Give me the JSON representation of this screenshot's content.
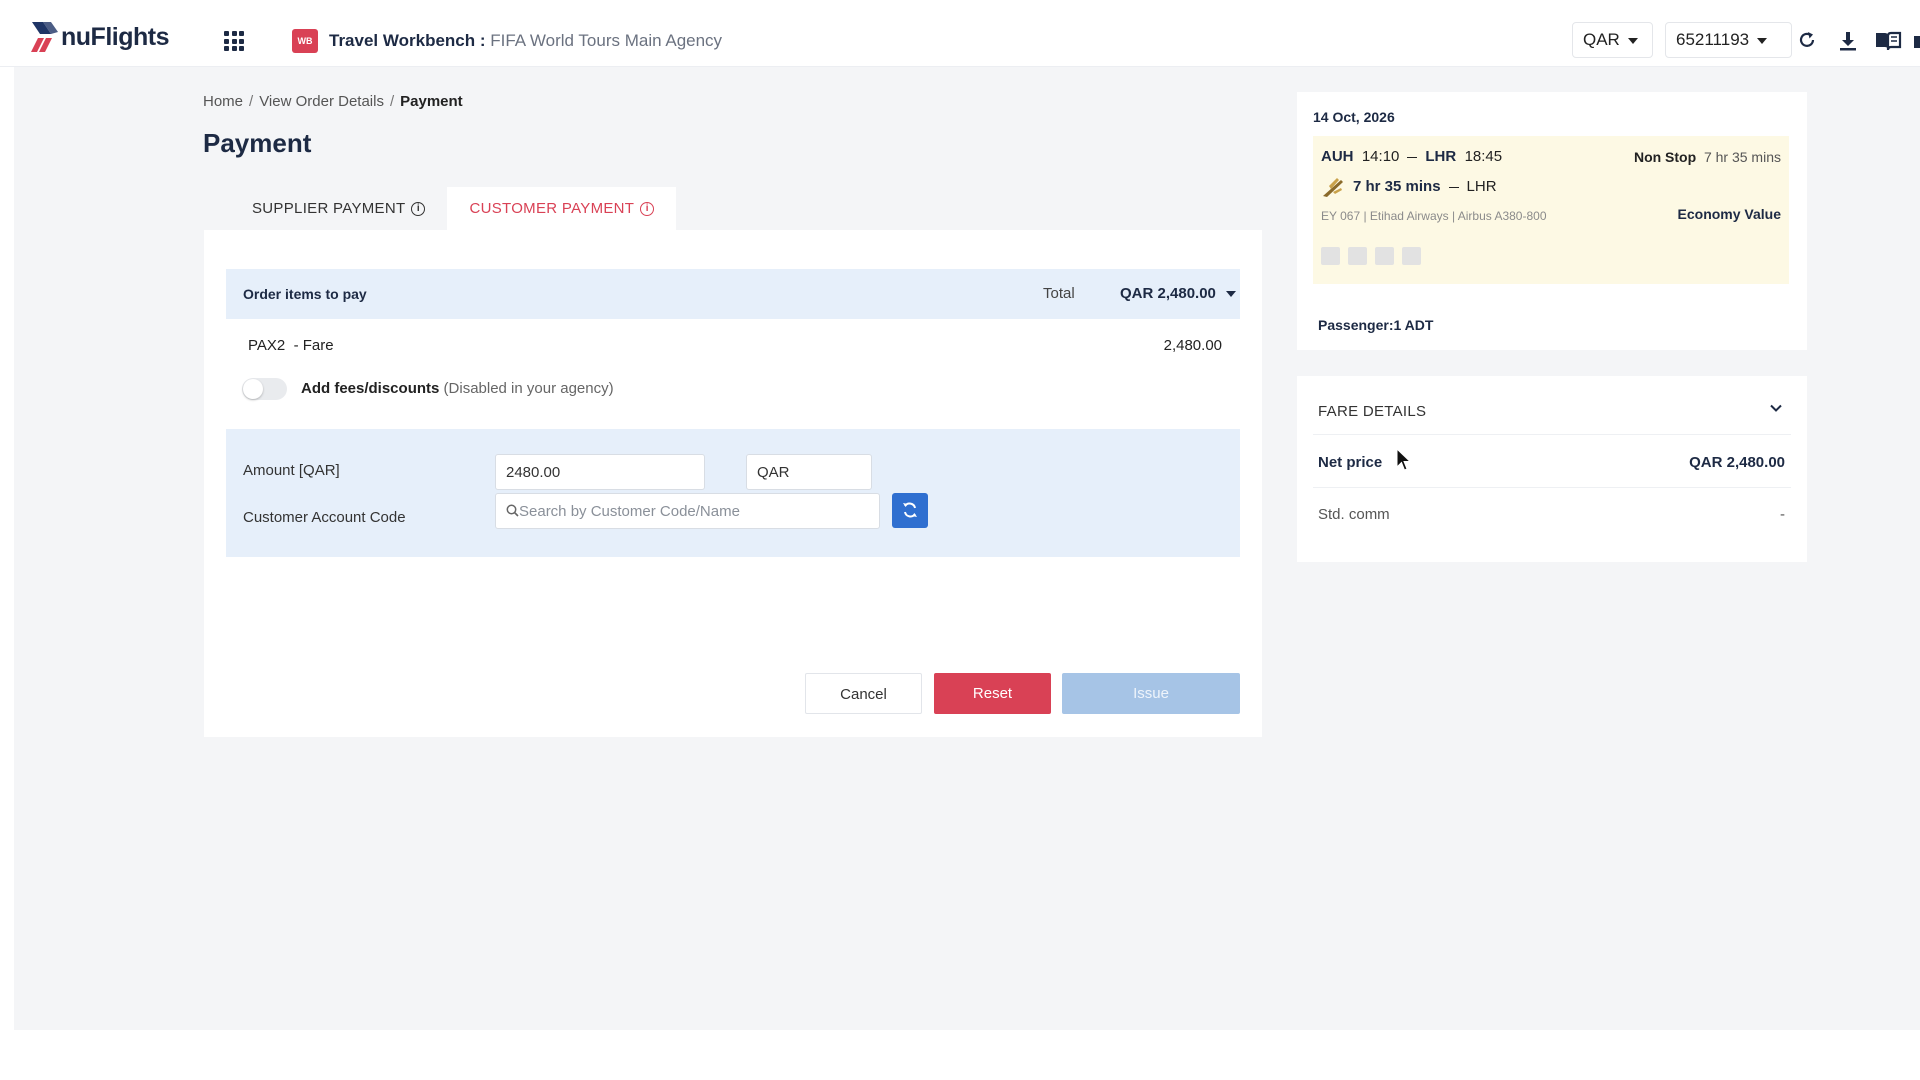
{
  "header": {
    "logo_text": "nuFlights",
    "workbench_icon": "WB",
    "workbench_title": "Travel Workbench :",
    "agency": "FIFA World Tours Main Agency",
    "currency": "QAR",
    "account": "65211193",
    "icons": [
      "apps-grid-icon",
      "refresh-icon",
      "download-icon",
      "book-icon"
    ]
  },
  "breadcrumb": {
    "home": "Home",
    "sep": "/",
    "order": "View Order Details",
    "current": "Payment"
  },
  "page_title": "Payment",
  "tabs": [
    {
      "label": "SUPPLIER PAYMENT",
      "active": false
    },
    {
      "label": "CUSTOMER PAYMENT",
      "active": true
    }
  ],
  "order": {
    "heading": "Order items to pay",
    "total_label": "Total",
    "total_value": "QAR 2,480.00",
    "item_label": "PAX2  - Fare",
    "item_value": "2,480.00",
    "fees_label": "Add fees/discounts",
    "fees_note": "(Disabled in your agency)"
  },
  "form": {
    "amount_label": "Amount [QAR]",
    "amount_value": "2480.00",
    "currency_value": "QAR",
    "account_label": "Customer Account Code",
    "account_placeholder": "Search by Customer Code/Name"
  },
  "buttons": {
    "cancel": "Cancel",
    "reset": "Reset",
    "issue": "Issue"
  },
  "flight": {
    "date": "14 Oct, 2026",
    "from": "AUH",
    "dep_time": "14:10",
    "to": "LHR",
    "arr_time": "18:45",
    "stops": "Non Stop",
    "duration": "7 hr 35 mins",
    "leg_duration": "7 hr 35 mins",
    "leg_dest": "LHR",
    "details": "EY 067 | Etihad Airways | Airbus A380-800",
    "cabin": "Economy Value",
    "passengers": "Passenger:1 ADT"
  },
  "fare_details": {
    "heading": "FARE DETAILS",
    "net_label": "Net price",
    "net_value": "QAR 2,480.00",
    "std_label": "Std. comm",
    "std_value": "-"
  },
  "colors": {
    "brand_red": "#d94155",
    "primary_blue": "#2f6fd0",
    "disabled_blue": "#a6c4e6",
    "navy": "#1d2a44",
    "segment_bg": "#fdf9e4",
    "form_bg": "#e6effa"
  }
}
